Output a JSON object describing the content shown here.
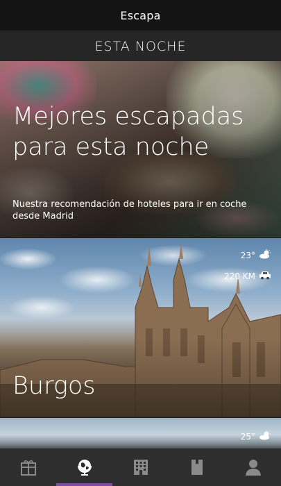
{
  "app": {
    "title": "Escapa"
  },
  "section": {
    "label": "ESTA NOCHE"
  },
  "hero": {
    "title": "Mejores escapadas para esta noche",
    "subtitle": "Nuestra recomendación de hoteles para ir en coche desde Madrid"
  },
  "cards": [
    {
      "city": "Burgos",
      "temperature": "23°",
      "weather_icon": "partly-cloudy-icon",
      "distance": "220 KM",
      "transport_icon": "car-icon"
    },
    {
      "city": "",
      "temperature": "25°",
      "weather_icon": "partly-cloudy-icon"
    }
  ],
  "nav": {
    "items": [
      {
        "icon": "gift-icon",
        "active": false
      },
      {
        "icon": "globe-icon",
        "active": true
      },
      {
        "icon": "hotel-icon",
        "active": false
      },
      {
        "icon": "bookmark-icon",
        "active": false
      },
      {
        "icon": "user-icon",
        "active": false
      }
    ],
    "active_color": "#7b4ea3"
  }
}
